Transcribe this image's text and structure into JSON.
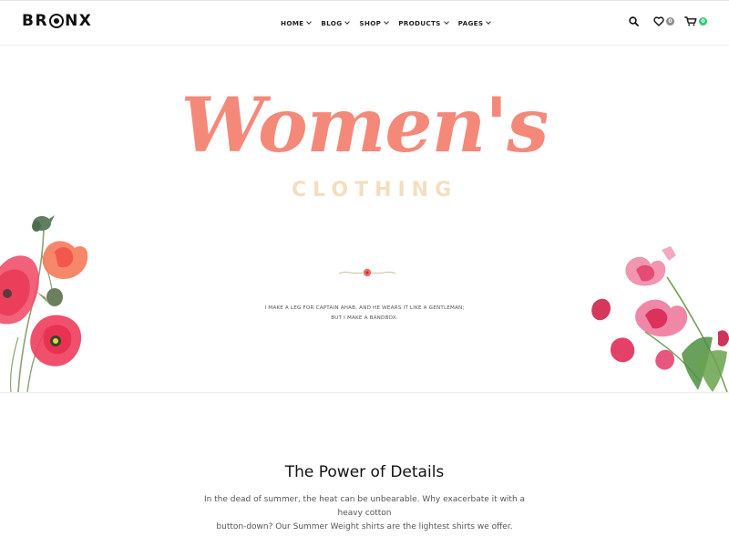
{
  "header": {
    "logo": {
      "left": "BR",
      "right": "NX"
    },
    "nav": [
      {
        "label": "HOME"
      },
      {
        "label": "BLOG"
      },
      {
        "label": "SHOP"
      },
      {
        "label": "PRODUCTS"
      },
      {
        "label": "PAGES"
      }
    ],
    "wishlist_count": "0",
    "cart_count": "0",
    "colors": {
      "cart_badge": "#2ecc71",
      "wishlist_badge": "#8d8d8d"
    }
  },
  "hero": {
    "headline": "Women's",
    "subheadline": "CLOTHING",
    "tagline_line1": "I MAKE A LEG FOR CAPTAIN AHAB, AND HE WEARS IT LIKE A GENTLEMAN;",
    "tagline_line2": "BUT I MAKE A BANDBOX.",
    "colors": {
      "headline": "#f4897a",
      "subheadline": "#f3dfc0"
    }
  },
  "details": {
    "title": "The Power of Details",
    "body_line1": "In the dead of summer, the heat can be unbearable. Why exacerbate it with a heavy cotton",
    "body_line2": "button-down? Our Summer Weight shirts are the lightest shirts we offer."
  }
}
